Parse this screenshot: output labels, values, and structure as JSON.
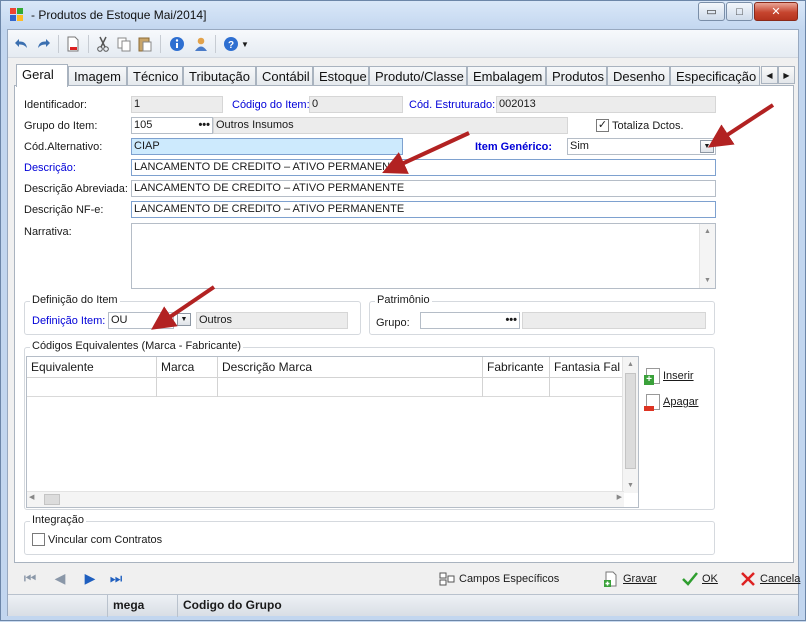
{
  "window": {
    "title": "-  Produtos de Estoque Mai/2014]",
    "buttons": {
      "minimize": "▭",
      "maximize": "□",
      "close": "✕"
    }
  },
  "toolbar": {
    "icons": [
      "undo-icon",
      "redo-icon",
      "new-document-icon",
      "cut-icon",
      "copy-icon",
      "paste-icon",
      "info-icon",
      "user-icon",
      "help-icon",
      "dropdown-arrow-icon"
    ]
  },
  "tabs": [
    "Geral",
    "Imagem",
    "Técnico",
    "Tributação",
    "Contábil",
    "Estoque",
    "Produto/Classe",
    "Embalagem",
    "Produtos",
    "Desenho",
    "Especificação"
  ],
  "active_tab": "Geral",
  "form": {
    "identificador": {
      "label": "Identificador:",
      "value": "1"
    },
    "codigo_item": {
      "label": "Código do Item:",
      "value": "0"
    },
    "cod_estruturado": {
      "label": "Cód. Estruturado:",
      "value": "002013"
    },
    "grupo_item": {
      "label": "Grupo do Item:",
      "value": "105",
      "ellipsis": "•••",
      "descricao": "Outros Insumos"
    },
    "totaliza": {
      "label": "Totaliza Dctos.",
      "checked": true,
      "mark": "✓"
    },
    "cod_alternativo": {
      "label": "Cód.Alternativo:",
      "value": "CIAP"
    },
    "item_generico": {
      "label": "Item Genérico:",
      "value": "Sim"
    },
    "descricao": {
      "label": "Descrição:",
      "value": "LANCAMENTO DE CREDITO – ATIVO PERMANENTE"
    },
    "descricao_abreviada": {
      "label": "Descrição Abreviada:",
      "value": "LANCAMENTO DE CREDITO – ATIVO PERMANENTE"
    },
    "descricao_nfe": {
      "label": "Descrição NF-e:",
      "value": "LANCAMENTO DE CREDITO – ATIVO PERMANENTE"
    },
    "narrativa": {
      "label": "Narrativa:",
      "value": ""
    }
  },
  "definicao": {
    "group_title": "Definição do Item",
    "label": "Definição Item:",
    "value": "OU",
    "descricao": "Outros"
  },
  "patrimonio": {
    "group_title": "Patrimônio",
    "label": "Grupo:",
    "ellipsis": "•••"
  },
  "codigos": {
    "group_title": "Códigos Equivalentes (Marca - Fabricante)",
    "columns": [
      "Equivalente",
      "Marca",
      "Descrição Marca",
      "Fabricante",
      "Fantasia Fal"
    ],
    "inserir": "Inserir",
    "apagar": "Apagar"
  },
  "integracao": {
    "group_title": "Integração",
    "vincular_label": "Vincular com Contratos",
    "checked": false
  },
  "actions": {
    "campos": "Campos Específicos",
    "gravar": "Gravar",
    "ok": "OK",
    "cancela": "Cancela"
  },
  "status": {
    "cell1": "",
    "cell2": "mega",
    "cell3": "Codigo do Grupo"
  },
  "colors": {
    "label_blue": "#0000d8",
    "arrow_red": "#b22222",
    "nav_blue": "#1f5fbf"
  }
}
